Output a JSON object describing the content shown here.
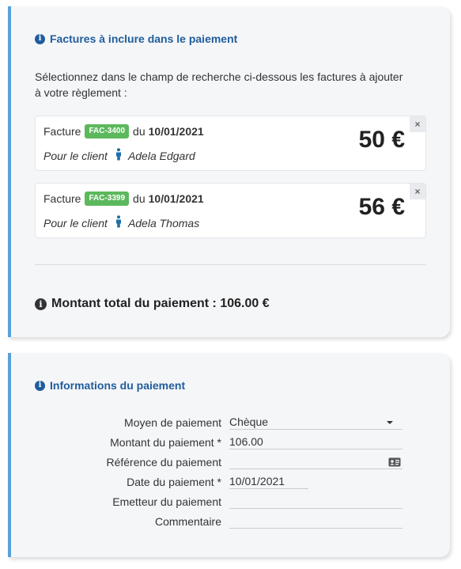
{
  "invoices_section": {
    "title": "Factures à inclure dans le paiement",
    "instructions": "Sélectionnez dans le champ de recherche ci-dessous les factures à ajouter à votre règlement :",
    "items": [
      {
        "prefix": "Facture",
        "number": "FAC-3400",
        "du": "du",
        "date": "10/01/2021",
        "client_label": "Pour le client",
        "client_name": "Adela Edgard",
        "amount": "50 €",
        "remove": "×"
      },
      {
        "prefix": "Facture",
        "number": "FAC-3399",
        "du": "du",
        "date": "10/01/2021",
        "client_label": "Pour le client",
        "client_name": "Adela Thomas",
        "amount": "56 €",
        "remove": "×"
      }
    ],
    "total_text": "Montant total du paiement : 106.00 €"
  },
  "payment_section": {
    "title": "Informations du paiement",
    "fields": {
      "method": {
        "label": "Moyen de paiement",
        "value": "Chèque"
      },
      "amount": {
        "label": "Montant du paiement *",
        "value": "106.00"
      },
      "reference": {
        "label": "Référence du paiement",
        "value": ""
      },
      "date": {
        "label": "Date du paiement *",
        "value": "10/01/2021"
      },
      "issuer": {
        "label": "Emetteur du paiement",
        "value": ""
      },
      "comment": {
        "label": "Commentaire",
        "value": ""
      }
    }
  },
  "colors": {
    "accent": "#5aa1d8",
    "title": "#1f5c9c",
    "badge": "#5cb85c",
    "person_icon": "#1f6ea8"
  },
  "icons": {
    "info": "info-circle-icon",
    "person": "person-icon",
    "close": "close-icon",
    "caret": "caret-down-icon",
    "id_card": "id-card-icon"
  }
}
